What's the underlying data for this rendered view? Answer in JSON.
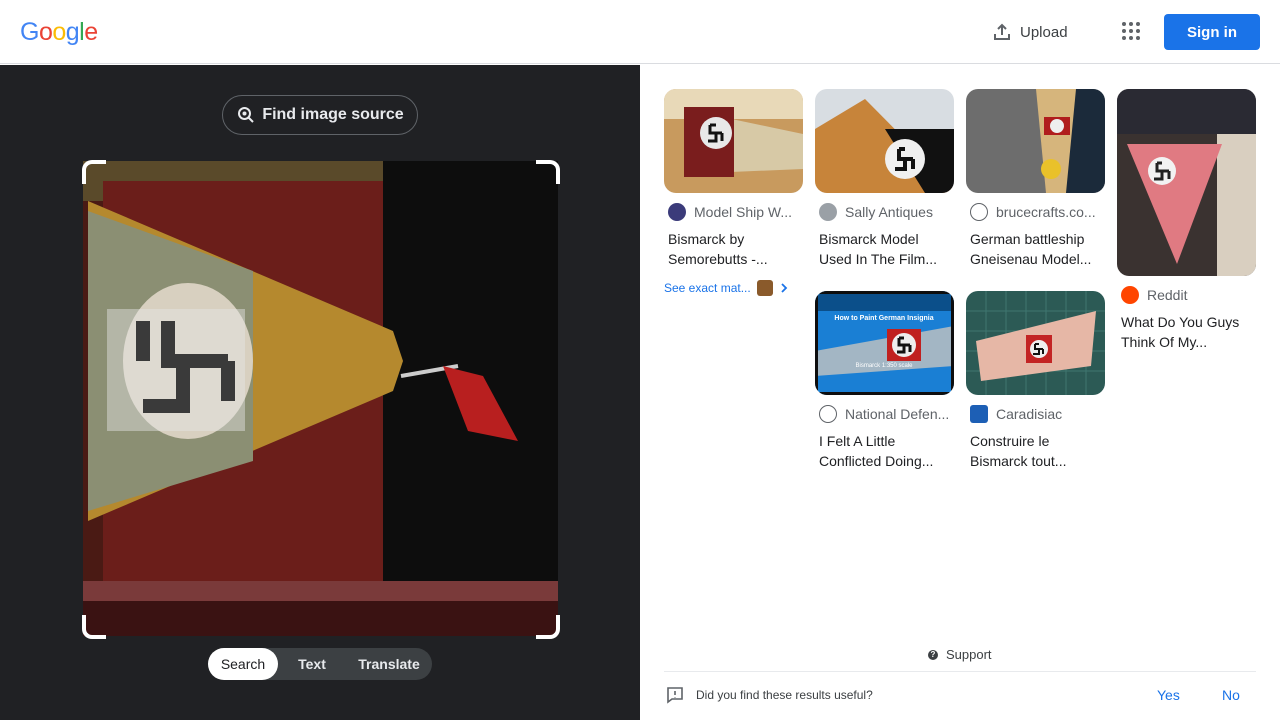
{
  "header": {
    "logo_letters": [
      {
        "ch": "G",
        "color": "#4285f4"
      },
      {
        "ch": "o",
        "color": "#ea4335"
      },
      {
        "ch": "o",
        "color": "#fbbc05"
      },
      {
        "ch": "g",
        "color": "#4285f4"
      },
      {
        "ch": "l",
        "color": "#34a853"
      },
      {
        "ch": "e",
        "color": "#ea4335"
      }
    ],
    "upload_label": "Upload",
    "sign_in_label": "Sign in",
    "accent": "#1a73e8"
  },
  "lens": {
    "find_source_label": "Find image source",
    "modes": [
      {
        "label": "Search",
        "active": true
      },
      {
        "label": "Text",
        "active": false
      },
      {
        "label": "Translate",
        "active": false
      }
    ]
  },
  "results": [
    {
      "source": "Model Ship W...",
      "title": "Bismarck by Semorebutts -...",
      "fav_icon": "model-ship-favicon"
    },
    {
      "source": "Sally Antiques",
      "title": "Bismarck Model Used In The Film...",
      "fav_icon": "sally-antiques-favicon"
    },
    {
      "source": "brucecrafts.co...",
      "title": "German battleship Gneisenau Model...",
      "fav_icon": "brucecrafts-favicon"
    },
    {
      "source": "Reddit",
      "title": "What Do You Guys Think Of My...",
      "fav_icon": "reddit-favicon"
    },
    {
      "source": "National Defen...",
      "title": "I Felt A Little Conflicted Doing...",
      "fav_icon": "globe-icon"
    },
    {
      "source": "Caradisiac",
      "title": "Construire le Bismarck tout...",
      "fav_icon": "caradisiac-favicon"
    }
  ],
  "see_exact_label": "See exact mat...",
  "thumb_caption": [
    "How to Paint German Insignia",
    "Bismarck 1:350 scale"
  ],
  "footer": {
    "support_label": "Support",
    "feedback_question": "Did you find these results useful?",
    "yes_label": "Yes",
    "no_label": "No"
  }
}
